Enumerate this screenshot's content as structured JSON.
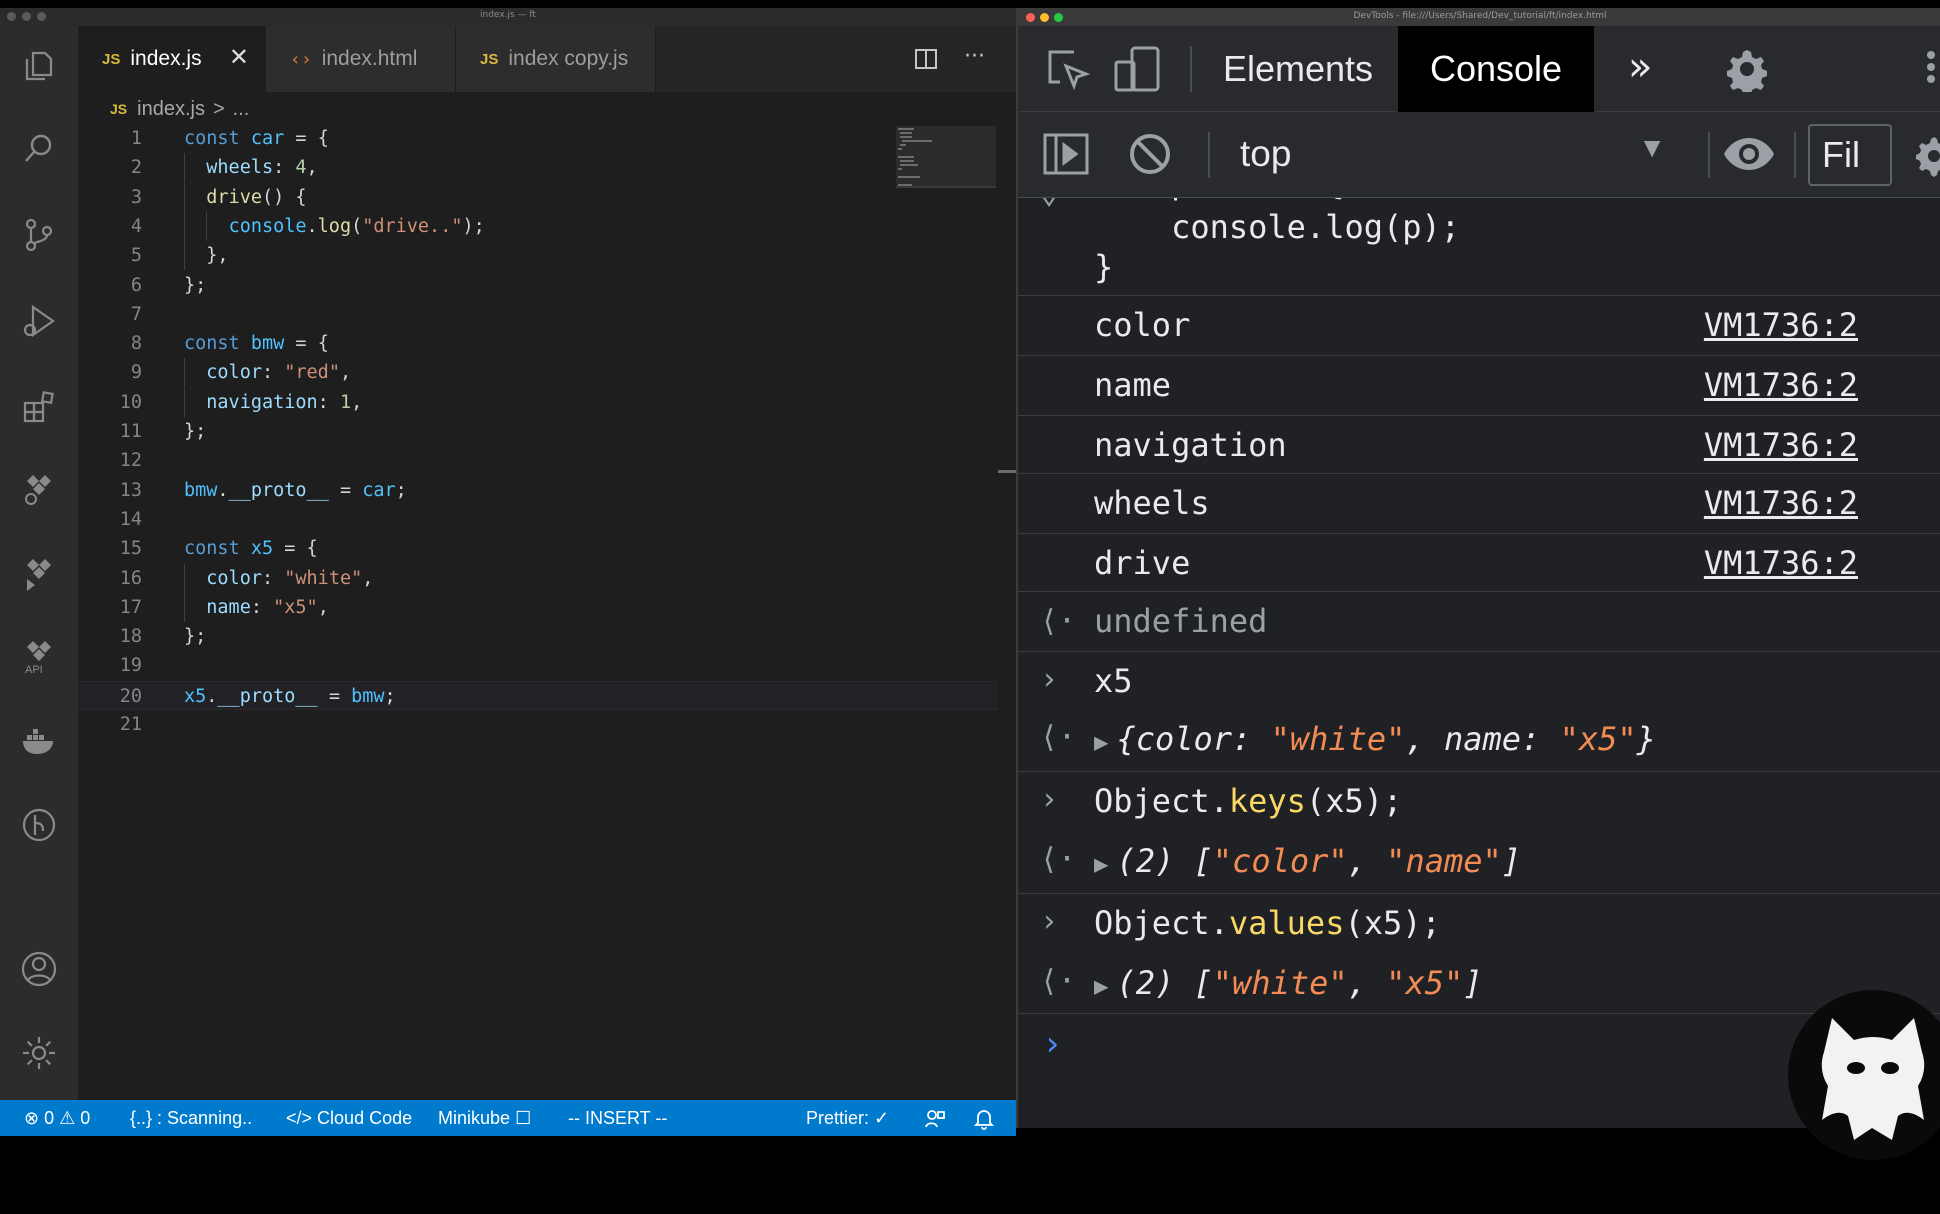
{
  "vscode": {
    "window_title": "index.js — ft",
    "tabs": [
      {
        "label": "index.js",
        "type": "JS",
        "active": true
      },
      {
        "label": "index.html",
        "type": "html",
        "active": false
      },
      {
        "label": "index copy.js",
        "type": "JS",
        "active": false
      }
    ],
    "breadcrumb": {
      "badge": "JS",
      "file": "index.js",
      "separator": ">",
      "more": "..."
    },
    "code_lines": [
      "const car = {",
      "  wheels: 4,",
      "  drive() {",
      "    console.log(\"drive..\");",
      "  },",
      "};",
      "",
      "const bmw = {",
      "  color: \"red\",",
      "  navigation: 1,",
      "};",
      "",
      "bmw.__proto__ = car;",
      "",
      "const x5 = {",
      "  color: \"white\",",
      "  name: \"x5\",",
      "};",
      "",
      "x5.__proto__ = bmw;",
      ""
    ],
    "line_numbers": [
      "1",
      "2",
      "3",
      "4",
      "5",
      "6",
      "7",
      "8",
      "9",
      "10",
      "11",
      "12",
      "13",
      "14",
      "15",
      "16",
      "17",
      "18",
      "19",
      "20",
      "21"
    ],
    "current_line": 20,
    "statusbar": {
      "errors": "0",
      "warnings": "0",
      "scanning": "{..} : Scanning..",
      "cloud_code": "Cloud Code",
      "minikube": "Minikube",
      "mode": "-- INSERT --",
      "prettier": "Prettier: ✓"
    },
    "colors": {
      "statusbar": "#007acc",
      "editor_bg": "#1e1e1e",
      "keyword": "#569cd6",
      "string": "#ce9178"
    }
  },
  "devtools": {
    "window_title": "DevTools - file:///Users/Shared/Dev_tutorial/ft/index.html",
    "tabs": [
      {
        "label": "Elements",
        "active": false
      },
      {
        "label": "Console",
        "active": true
      }
    ],
    "context": "top",
    "filter_placeholder": "Fil",
    "console_entries": {
      "partial_code_1": "    console.log(p);",
      "partial_code_2": "}",
      "logs": [
        {
          "text": "color",
          "source": "VM1736:2"
        },
        {
          "text": "name",
          "source": "VM1736:2"
        },
        {
          "text": "navigation",
          "source": "VM1736:2"
        },
        {
          "text": "wheels",
          "source": "VM1736:2"
        },
        {
          "text": "drive",
          "source": "VM1736:2"
        }
      ],
      "undefined_result": "undefined",
      "input_1": "x5",
      "result_1": {
        "prefix": "{",
        "k1": "color",
        "v1": "\"white\"",
        "k2": "name",
        "v2": "\"x5\"",
        "suffix": "}"
      },
      "input_2": {
        "obj": "Object.",
        "method": "keys",
        "args": "(x5);"
      },
      "result_2": {
        "count": "(2)",
        "v1": "\"color\"",
        "v2": "\"name\""
      },
      "input_3": {
        "obj": "Object.",
        "method": "values",
        "args": "(x5);"
      },
      "result_3": {
        "count": "(2)",
        "v1": "\"white\"",
        "v2": "\"x5\""
      }
    },
    "colors": {
      "background": "#202124",
      "string": "#f28b54",
      "method": "#f9d866",
      "prompt": "#4a8bf5"
    }
  }
}
